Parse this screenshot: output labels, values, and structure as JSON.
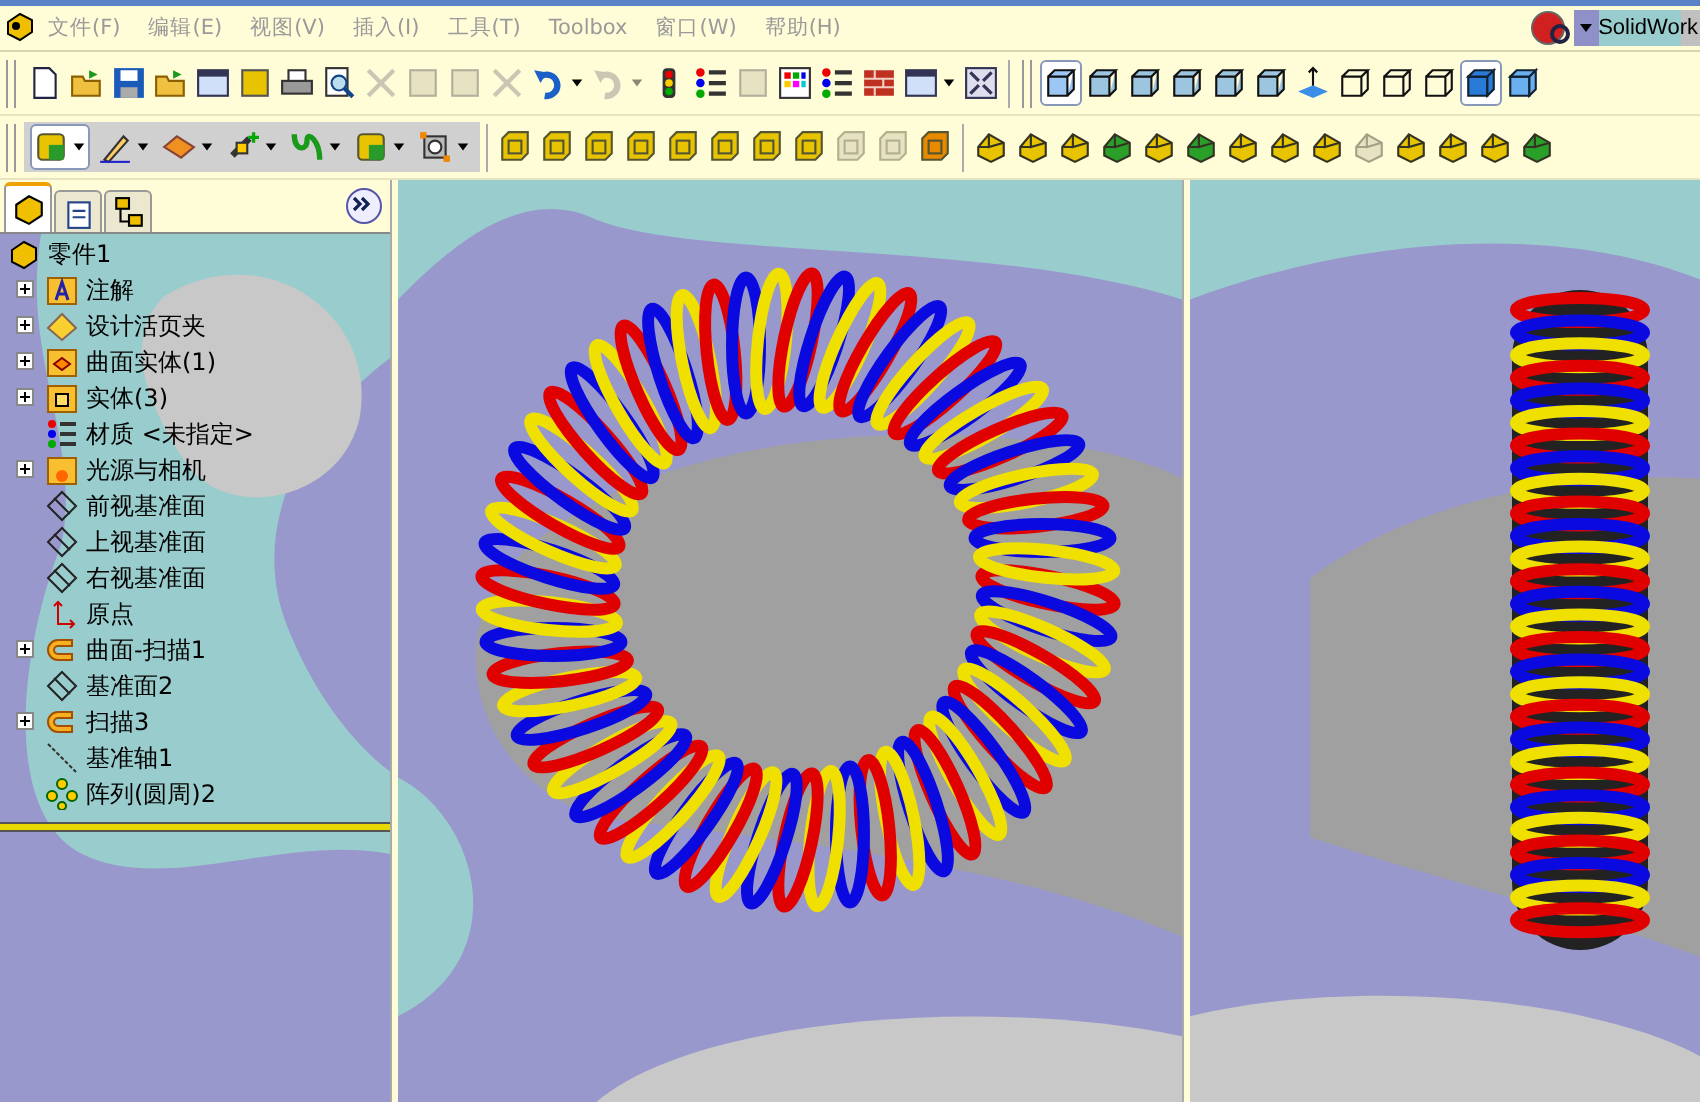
{
  "menu": [
    {
      "label": "文件(F)"
    },
    {
      "label": "编辑(E)"
    },
    {
      "label": "视图(V)"
    },
    {
      "label": "插入(I)"
    },
    {
      "label": "工具(T)"
    },
    {
      "label": "Toolbox"
    },
    {
      "label": "窗口(W)"
    },
    {
      "label": "帮助(H)"
    }
  ],
  "search": {
    "label": "SolidWork"
  },
  "panel_tabs": [
    {
      "kind": "tree",
      "selected": true
    },
    {
      "kind": "property",
      "selected": false
    },
    {
      "kind": "config",
      "selected": false
    }
  ],
  "tree": {
    "label": "零件1",
    "children": [
      {
        "label": "注解",
        "kind": "annotation",
        "expanded": false
      },
      {
        "label": "设计活页夹",
        "kind": "binder",
        "expanded": false
      },
      {
        "label": "曲面实体(1)",
        "kind": "surface",
        "expanded": false
      },
      {
        "label": "实体(3)",
        "kind": "solid",
        "expanded": false
      },
      {
        "label": "材质 <未指定>",
        "kind": "material"
      },
      {
        "label": "光源与相机",
        "kind": "light",
        "expanded": false
      },
      {
        "label": "前视基准面",
        "kind": "plane"
      },
      {
        "label": "上视基准面",
        "kind": "plane"
      },
      {
        "label": "右视基准面",
        "kind": "plane"
      },
      {
        "label": "原点",
        "kind": "origin"
      },
      {
        "label": "曲面-扫描1",
        "kind": "sweep",
        "expanded": false
      },
      {
        "label": "基准面2",
        "kind": "plane"
      },
      {
        "label": "扫描3",
        "kind": "sweep",
        "expanded": false
      },
      {
        "label": "基准轴1",
        "kind": "axis"
      },
      {
        "label": "阵列(圆周)2",
        "kind": "pattern"
      }
    ]
  }
}
